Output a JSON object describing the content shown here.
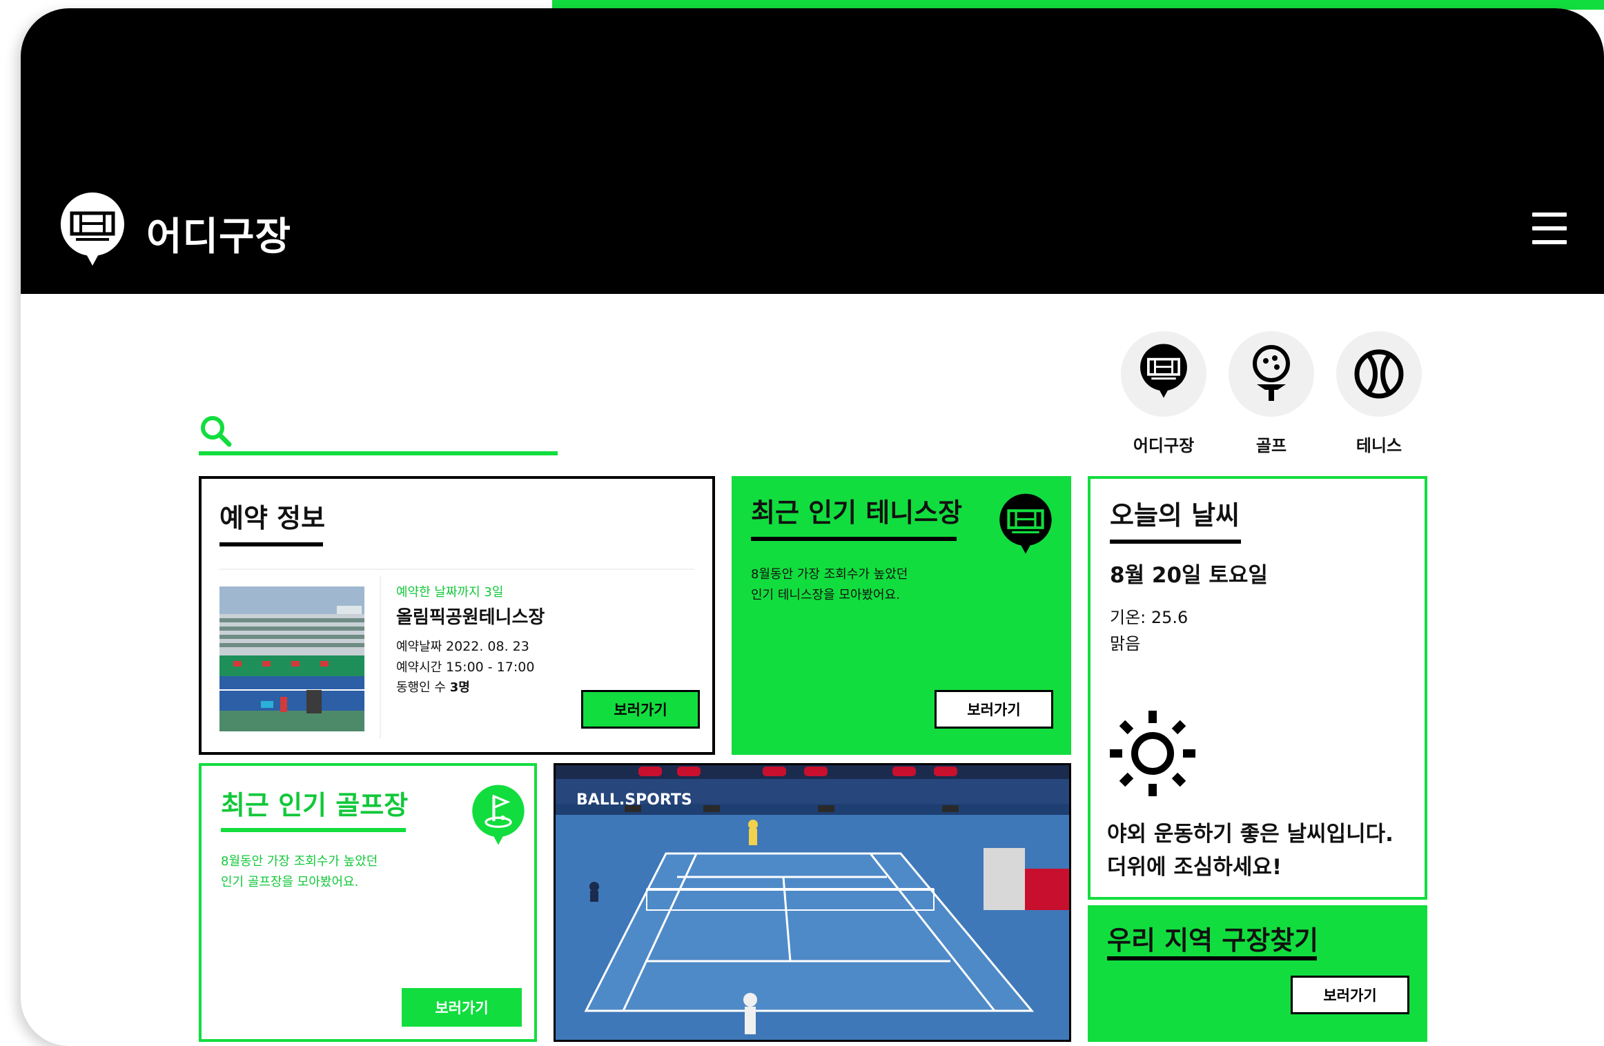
{
  "header": {
    "app_name": "어디구장",
    "logo_icon": "court-pin-icon",
    "menu_icon": "hamburger-menu-icon"
  },
  "search": {
    "placeholder": "",
    "value": ""
  },
  "categories": [
    {
      "label": "어디구장",
      "icon": "court-pin-icon"
    },
    {
      "label": "골프",
      "icon": "golf-ball-tee-icon"
    },
    {
      "label": "테니스",
      "icon": "tennis-ball-icon"
    }
  ],
  "reservation": {
    "title": "예약 정보",
    "countdown": "예약한 날짜까지 3일",
    "venue": "올림픽공원테니스장",
    "date_label": "예약날짜",
    "date_value": "2022. 08. 23",
    "time_label": "예약시간",
    "time_value": "15:00 - 17:00",
    "companions_label": "동행인 수",
    "companions_value": "3명",
    "button": "보러가기"
  },
  "popular_tennis": {
    "title": "최근 인기 테니스장",
    "desc_line1": "8월동안 가장 조회수가 높았던",
    "desc_line2": "인기 테니스장을 모아봤어요.",
    "button": "보러가기"
  },
  "weather": {
    "title": "오늘의 날씨",
    "date": "8월 20일 토요일",
    "temp": "기온: 25.6",
    "condition": "맑음",
    "icon": "sun-icon",
    "message_line1": "야외 운동하기 좋은 날씨입니다.",
    "message_line2": "더위에 조심하세요!"
  },
  "popular_golf": {
    "title": "최근 인기 골프장",
    "desc_line1": "8월동안 가장 조회수가 높았던",
    "desc_line2": "인기 골프장을 모아봤어요.",
    "button": "보러가기"
  },
  "video": {
    "watermark": "BALL.SPORTS"
  },
  "local": {
    "title": "우리 지역 구장찾기",
    "button": "보러가기"
  },
  "colors": {
    "accent": "#12dd3e",
    "header_bg": "#000000",
    "text": "#111111"
  }
}
